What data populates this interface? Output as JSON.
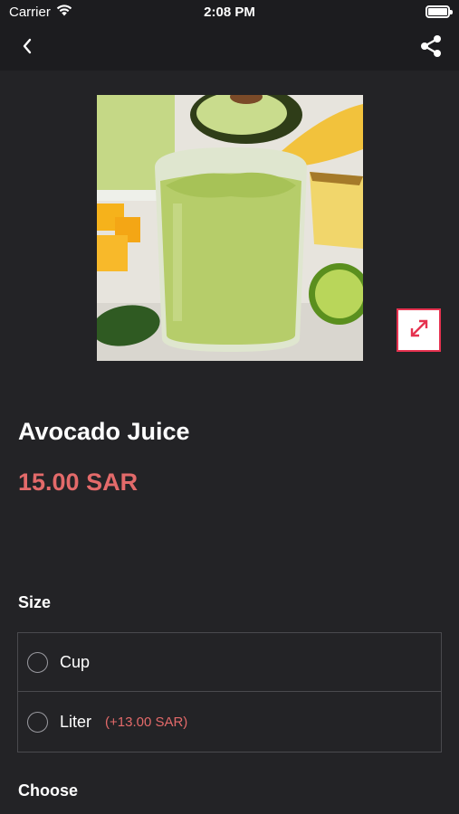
{
  "status_bar": {
    "carrier": "Carrier",
    "time": "2:08 PM"
  },
  "nav": {
    "back_icon": "chevron-left-icon",
    "share_icon": "share-icon"
  },
  "product": {
    "name": "Avocado Juice",
    "price": "15.00 SAR",
    "image_alt": "avocado-smoothie-image"
  },
  "size_section": {
    "title": "Size",
    "options": [
      {
        "label": "Cup",
        "extra": ""
      },
      {
        "label": "Liter",
        "extra": "(+13.00 SAR)"
      }
    ]
  },
  "choose_section": {
    "title": "Choose"
  },
  "colors": {
    "background": "#232326",
    "accent": "#e36a6a",
    "expand_border": "#e5324f"
  }
}
